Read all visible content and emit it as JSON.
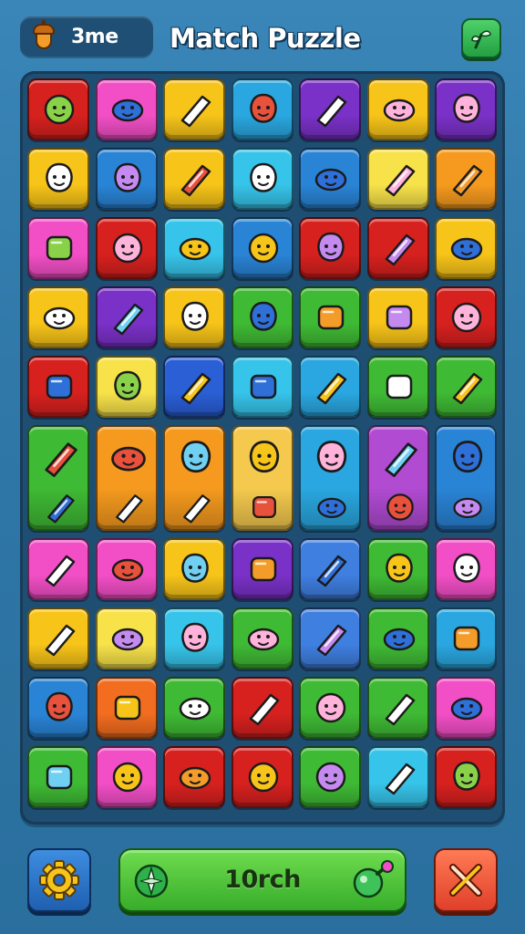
{
  "header": {
    "resource_count": "3me",
    "resource_icon": "acorn-icon",
    "title": "Match Puzzle",
    "top_button_icon": "sprout-icon"
  },
  "board": {
    "rows": [
      {
        "kind": "small",
        "tiles": [
          {
            "color": "#d7211f",
            "icon": "cookie-icon"
          },
          {
            "color": "#f24fc6",
            "icon": "biscuit-icon"
          },
          {
            "color": "#f7c419",
            "icon": "bread-icon"
          },
          {
            "color": "#2aa7e0",
            "icon": "ghost-icon"
          },
          {
            "color": "#7a31c7",
            "icon": "bug-icon"
          },
          {
            "color": "#f7c419",
            "icon": "leaf-icon"
          },
          {
            "color": "#7a31c7",
            "icon": "pipe-icon"
          }
        ]
      },
      {
        "kind": "small",
        "tiles": [
          {
            "color": "#f7c419",
            "icon": "crossed-tools-icon"
          },
          {
            "color": "#2a84d6",
            "icon": "magnifier-icon"
          },
          {
            "color": "#f7c419",
            "icon": "pencil-icon"
          },
          {
            "color": "#37c4ea",
            "icon": "logs-icon"
          },
          {
            "color": "#2a84d6",
            "icon": "crayon-icon"
          },
          {
            "color": "#f7e24a",
            "icon": "red-gem-icon"
          },
          {
            "color": "#f59a1e",
            "icon": "cheese-icon"
          }
        ]
      },
      {
        "kind": "small",
        "tiles": [
          {
            "color": "#f24fc6",
            "icon": "broom-icon"
          },
          {
            "color": "#d7211f",
            "icon": "corn-icon"
          },
          {
            "color": "#37c4ea",
            "icon": "bottle-icon"
          },
          {
            "color": "#2a84d6",
            "icon": "gear-eye-icon"
          },
          {
            "color": "#d7211f",
            "icon": "lemon-icon"
          },
          {
            "color": "#d7211f",
            "icon": "heart-icon"
          },
          {
            "color": "#f7c419",
            "icon": "radio-icon"
          }
        ]
      },
      {
        "kind": "small",
        "tiles": [
          {
            "color": "#f7c419",
            "icon": "smiley-icon"
          },
          {
            "color": "#7a31c7",
            "icon": "rattle-icon"
          },
          {
            "color": "#f7c419",
            "icon": "football-icon"
          },
          {
            "color": "#3fba35",
            "icon": "carrot-icon"
          },
          {
            "color": "#3fba35",
            "icon": "bear-icon"
          },
          {
            "color": "#f7c419",
            "icon": "orange-face-icon"
          },
          {
            "color": "#d7211f",
            "icon": "skull-icon"
          }
        ]
      },
      {
        "kind": "small",
        "tiles": [
          {
            "color": "#d7211f",
            "icon": "key-icon"
          },
          {
            "color": "#f7e24a",
            "icon": "gift-icon"
          },
          {
            "color": "#2a5fd6",
            "icon": "cake-icon"
          },
          {
            "color": "#37c4ea",
            "icon": "windmill-icon"
          },
          {
            "color": "#2aa7e0",
            "icon": "ice-cream-icon"
          },
          {
            "color": "#3fba35",
            "icon": "donut-icon"
          },
          {
            "color": "#3fba35",
            "icon": "bucket-icon"
          }
        ]
      },
      {
        "kind": "tall",
        "tiles": [
          {
            "color": "#3fba35",
            "icon": "fox-icon",
            "sub_icon": "sausage-icon"
          },
          {
            "color": "#f59a1e",
            "icon": "acorn-face-icon",
            "sub_icon": "coil-icon"
          },
          {
            "color": "#f59a1e",
            "icon": "cat-icon",
            "sub_icon": "coil-icon"
          },
          {
            "color": "#f4c94e",
            "icon": "crown-face-icon",
            "sub_icon": "bow-icon"
          },
          {
            "color": "#2aa7e0",
            "icon": "gnome-icon",
            "sub_icon": "hand-icon"
          },
          {
            "color": "#b04bd2",
            "icon": "king-icon",
            "sub_icon": "turtle-icon"
          },
          {
            "color": "#2a84d6",
            "icon": "fox-face-icon",
            "sub_icon": "leaf-pile-icon"
          }
        ]
      },
      {
        "kind": "small",
        "tiles": [
          {
            "color": "#f24fc6",
            "icon": "alarm-icon"
          },
          {
            "color": "#f24fc6",
            "icon": "flower-gear-icon"
          },
          {
            "color": "#f7c419",
            "icon": "pepper-icon"
          },
          {
            "color": "#7a31c7",
            "icon": "ghost-cat-icon"
          },
          {
            "color": "#3f7fe0",
            "icon": "seahorse-icon"
          },
          {
            "color": "#3fba35",
            "icon": "ring-icon"
          },
          {
            "color": "#f24fc6",
            "icon": "vase-icon"
          }
        ]
      },
      {
        "kind": "small",
        "tiles": [
          {
            "color": "#f7c419",
            "icon": "panda-icon"
          },
          {
            "color": "#f7e24a",
            "icon": "polar-bear-icon"
          },
          {
            "color": "#37c4ea",
            "icon": "crossed-swords-icon"
          },
          {
            "color": "#3fba35",
            "icon": "eye-orb-icon"
          },
          {
            "color": "#3f7fe0",
            "icon": "cookie-ring-icon"
          },
          {
            "color": "#3fba35",
            "icon": "blob-icon"
          },
          {
            "color": "#2aa7e0",
            "icon": "slingshot-icon"
          }
        ]
      },
      {
        "kind": "small",
        "tiles": [
          {
            "color": "#2a84d6",
            "icon": "crossbones-icon"
          },
          {
            "color": "#f26d1f",
            "icon": "pill-icon"
          },
          {
            "color": "#3fba35",
            "icon": "lollipop-icon"
          },
          {
            "color": "#d7211f",
            "icon": "star-burst-icon"
          },
          {
            "color": "#3fba35",
            "icon": "mushroom-icon"
          },
          {
            "color": "#3fba35",
            "icon": "spiral-icon"
          },
          {
            "color": "#f24fc6",
            "icon": "chef-icon"
          }
        ]
      },
      {
        "kind": "small",
        "tiles": [
          {
            "color": "#3fba35",
            "icon": "bear-face-icon"
          },
          {
            "color": "#f24fc6",
            "icon": "duck-icon"
          },
          {
            "color": "#d7211f",
            "icon": "frog-ring-icon"
          },
          {
            "color": "#d7211f",
            "icon": "eraser-icon"
          },
          {
            "color": "#3fba35",
            "icon": "marker-icon"
          },
          {
            "color": "#37c4ea",
            "icon": "white-bear-icon"
          },
          {
            "color": "#d7211f",
            "icon": "green-goblin-icon"
          }
        ]
      }
    ]
  },
  "footer": {
    "settings_icon": "gear-icon",
    "action_label": "10rch",
    "action_left_icon": "compass-icon",
    "action_right_icon": "potion-icon",
    "close_icon": "crossed-tools-icon"
  }
}
